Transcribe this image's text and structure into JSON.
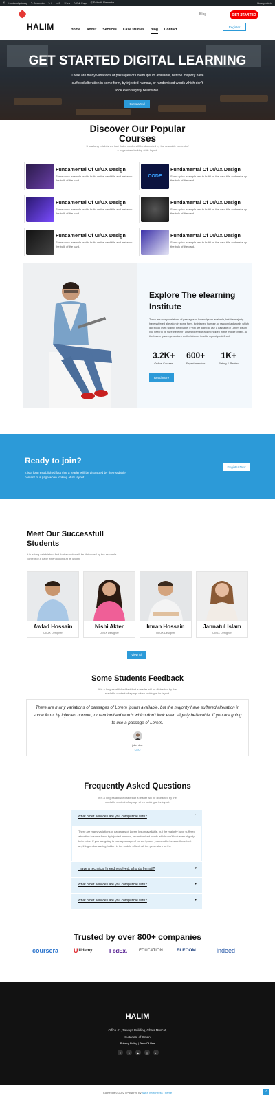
{
  "admin_bar": {
    "items": [
      "herohowlgateway",
      "Customize",
      "0",
      "0",
      "New",
      "Edit Page",
      "Edit with Elementor"
    ],
    "right": "Howdy, admin"
  },
  "header": {
    "logo": "HALIM",
    "nav": [
      "Home",
      "About",
      "Services",
      "Case studies",
      "Blog",
      "Contact"
    ],
    "blog_link": "Blog",
    "cta": "GET STARTED",
    "register": "Register"
  },
  "hero": {
    "title": "GET STARTED DIGITAL LEARNING",
    "text": "There are many variations of passages of Lorem Ipsum available, but the majority have suffered alteration in some form, by injected humour, or randomised words which don't look even slightly believable.",
    "button": "Get started"
  },
  "courses": {
    "title_line1": "Discover Our Popular",
    "title_line2": "Courses",
    "subtitle": "It is a long established fact that a reader will be distracted by the readable content of a page when looking at its layout.",
    "items": [
      {
        "title": "Fundamental Of UI/UX Design",
        "desc": "Some quick example text to build on the card title and make up the bulk of the card."
      },
      {
        "title": "Fundamental Of UI/UX Design",
        "desc": "Some quick example text to build on the card title and make up the bulk of the card."
      },
      {
        "title": "Fundamental Of UI/UX Design",
        "desc": "Some quick example text to build on the card title and make up the bulk of the card."
      },
      {
        "title": "Fundamental Of UI/UX Design",
        "desc": "Some quick example text to build on the card title and make up the bulk of the card."
      },
      {
        "title": "Fundamental Of UI/UX Design",
        "desc": "Some quick example text to build on the card title and make up the bulk of the card."
      },
      {
        "title": "Fundamental Of UI/UX Design",
        "desc": "Some quick example text to build on the card title and make up the bulk of the card."
      }
    ],
    "thumb_code_text": "CODE"
  },
  "explore": {
    "title": "Explore The elearning Institute",
    "text": "There are many variations of passages of Lorem Ipsum available, but the majority have suffered alteration in some form, by injected humour, or randomised words which don't look even slightly believable. If you are going to use a passage of Lorem Ipsum, you need to be sure there isn't anything embarrassing hidden in the middle of text. All the Lorem Ipsum generators on the Internet tend to repeat predefined.",
    "stats": [
      {
        "number": "3.2K+",
        "label": "Online Courses"
      },
      {
        "number": "600+",
        "label": "Expert member"
      },
      {
        "number": "1K+",
        "label": "Rating & Review"
      }
    ],
    "button": "Read more"
  },
  "ready": {
    "title": "Ready to join?",
    "text": "It is a long established fact that a reader will be distracted by the readable content of a page when looking at its layout.",
    "button": "Register Now"
  },
  "students": {
    "title": "Meet Our Successfull Students",
    "subtitle": "It is a long established fact that a reader will be distracted by the readable content of a page when looking at its layout.",
    "items": [
      {
        "name": "Awlad Hossain",
        "role": "UI/UX Designer"
      },
      {
        "name": "Nishi Akter",
        "role": "UI/UX Designer"
      },
      {
        "name": "Imran Hossain",
        "role": "UI/UX Designer"
      },
      {
        "name": "Jannatul Islam",
        "role": "UI/UX Designer"
      }
    ],
    "button": "View All"
  },
  "feedback": {
    "title": "Some Students Feedback",
    "subtitle": "It is a long established fact that a reader will be distracted by the readable content of a page when looking at its layout.",
    "quote": "There are many variations of passages of Lorem Ipsum available, but the majority have suffered alteration in some form, by injected humour, or randomised words which don't look even slightly believable. If you are going to use a passage of Lorem.",
    "name": "john doe",
    "role": "CEO"
  },
  "faq": {
    "title": "Frequently Asked Questions",
    "subtitle": "It is a long established fact that a reader will be distracted by the readable content of a page when looking at its layout.",
    "items": [
      {
        "q": "What other services are you compatible with?"
      },
      {
        "q": "I have a technical I need resolved, who do I email?"
      },
      {
        "q": "What other services are you compatible with?"
      },
      {
        "q": "What other services are you compatible with?"
      }
    ],
    "answer": "There are many variations of passages of Lorem Ipsum available, but the majority have suffered alteration in some form, by injected humour, or randomised words which don't look even slightly believable. If you are going to use a passage of Lorem Ipsum, you need to be sure there isn't anything embarrassing hidden in the middle of text. All the generators on the"
  },
  "partners": {
    "title": "Trusted by over 800+ companies",
    "logos": [
      "coursera",
      "Udemy",
      "FedEx.",
      "EDUCATION",
      "ELECOM",
      "indeed"
    ]
  },
  "footer": {
    "logo": "HALIM",
    "address_line1": "Office 41, Zawaya Building, Ghala Muscat,",
    "address_line2": "Sultanate of Oman",
    "links": "Privacy Policy | Term Of Use",
    "copyright_prefix": "Copyright © 2022 | Powered by",
    "copyright_link": "Astra WordPress Theme"
  },
  "colors": {
    "accent": "#2c9ad8",
    "cta_red": "#f50000",
    "footer_bg": "#121212"
  }
}
